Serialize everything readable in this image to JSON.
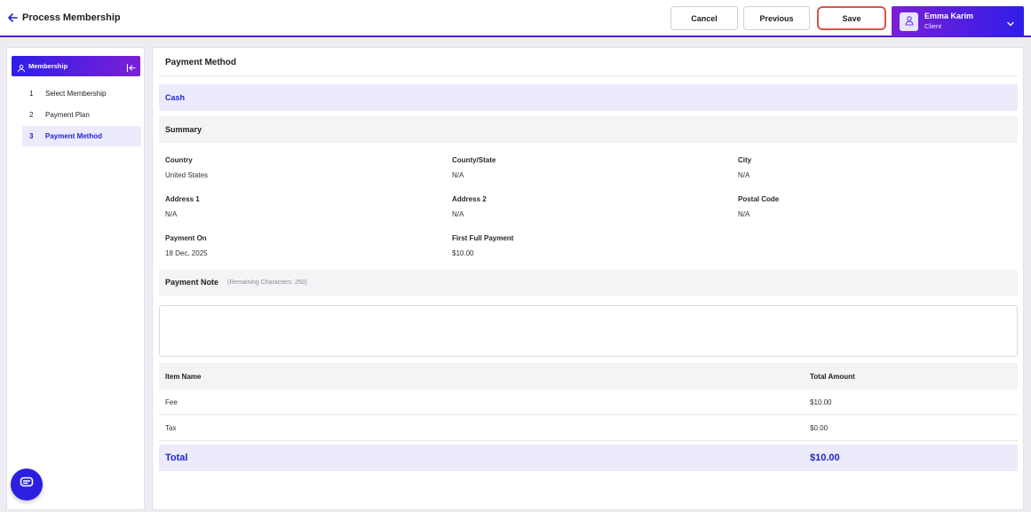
{
  "header": {
    "back_icon": "arrow-left-icon",
    "title": "Process Membership",
    "cancel_label": "Cancel",
    "previous_label": "Previous",
    "save_label": "Save",
    "user": {
      "name": "Emma Karim",
      "role": "Client",
      "avatar_icon": "user-icon",
      "chevron_icon": "chevron-down-icon"
    }
  },
  "sidebar": {
    "title": "Membership",
    "title_icon": "user-icon",
    "collapse_icon": "collapse-left-icon",
    "steps": [
      {
        "num": "1",
        "label": "Select Membership"
      },
      {
        "num": "2",
        "label": "Payment Plan"
      },
      {
        "num": "3",
        "label": "Payment Method",
        "active": true
      }
    ]
  },
  "main": {
    "section_title": "Payment Method",
    "method": "Cash",
    "summary_title": "Summary",
    "fields": {
      "country": {
        "label": "Country",
        "value": "United States"
      },
      "county_state": {
        "label": "County/State",
        "value": "N/A"
      },
      "city": {
        "label": "City",
        "value": "N/A"
      },
      "address1": {
        "label": "Address 1",
        "value": "N/A"
      },
      "address2": {
        "label": "Address 2",
        "value": "N/A"
      },
      "postal_code": {
        "label": "Postal Code",
        "value": "N/A"
      },
      "payment_on": {
        "label": "Payment On",
        "value": "18 Dec, 2025"
      },
      "first_full_payment": {
        "label": "First Full Payment",
        "value": "$10.00"
      }
    },
    "note": {
      "label": "Payment Note",
      "hint": "(Remaining Characters: 250)",
      "value": ""
    },
    "table": {
      "headers": {
        "item": "Item Name",
        "amount": "Total Amount"
      },
      "rows": [
        {
          "item": "Fee",
          "amount": "$10.00"
        },
        {
          "item": "Tax",
          "amount": "$0.00"
        }
      ],
      "total_label": "Total",
      "total_value": "$10.00"
    }
  },
  "chat": {
    "icon": "chat-icon"
  },
  "colors": {
    "accent": "#2323d4",
    "gradient_start": "#7b1fd6",
    "gradient_end": "#2f1ee8",
    "save_outline": "#d9534f"
  }
}
